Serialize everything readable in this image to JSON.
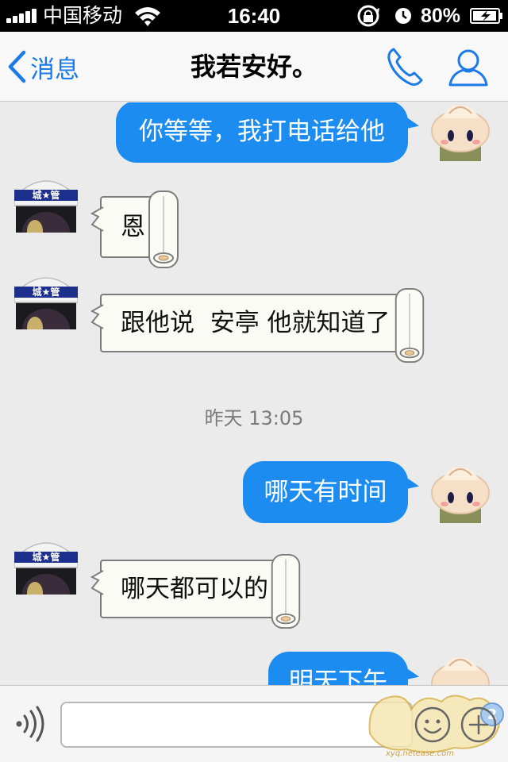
{
  "status_bar": {
    "carrier": "中国移动",
    "time": "16:40",
    "battery_percent": "80%"
  },
  "nav": {
    "back_label": "消息",
    "title": "我若安好。"
  },
  "messages": [
    {
      "side": "right",
      "style": "blue",
      "text": "你等等，我打电话给他"
    },
    {
      "side": "left",
      "style": "paper",
      "text": "恩"
    },
    {
      "side": "left",
      "style": "paper",
      "text": "跟他说  安亭 他就知道了"
    },
    {
      "side": "center",
      "style": "timestamp",
      "text": "昨天 13:05"
    },
    {
      "side": "right",
      "style": "blue",
      "text": "哪天有时间"
    },
    {
      "side": "left",
      "style": "paper",
      "text": "哪天都可以的"
    },
    {
      "side": "right",
      "style": "blue",
      "text": "明天下午"
    }
  ],
  "guard_helmet_text": "城★管",
  "input": {
    "value": "",
    "placeholder": ""
  },
  "watermark_url": "xyq.netease.com",
  "colors": {
    "accent": "#1a7ae8",
    "sent_bubble": "#1c8cf0",
    "chat_background": "#ebebeb"
  },
  "icons": [
    "back-chevron-icon",
    "phone-icon",
    "contact-icon",
    "voice-icon",
    "emoji-icon",
    "plus-icon",
    "wifi-icon",
    "lock-rotation-icon",
    "alarm-icon",
    "battery-icon"
  ]
}
